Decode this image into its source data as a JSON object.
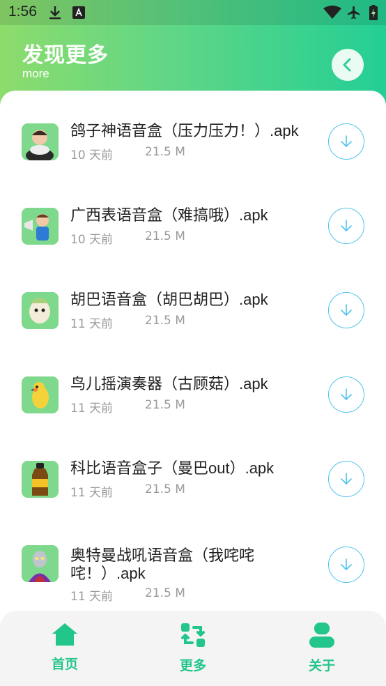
{
  "status_bar": {
    "time": "1:56",
    "icons": [
      "download-icon",
      "text-a-icon",
      "wifi-icon",
      "airplane-mode-icon",
      "battery-charging-icon"
    ]
  },
  "header": {
    "title": "发现更多",
    "subtitle": "more",
    "back_icon": "chevron-left-icon"
  },
  "colors": {
    "header_gradient_start": "#8ddc6c",
    "header_gradient_end": "#23cf95",
    "accent": "#22c58a",
    "download_ring": "#4fc3ec",
    "meta_text": "#9a9a9a"
  },
  "items": [
    {
      "title": "鸽子神语音盒（压力压力！）.apk",
      "age": "10 天前",
      "size": "21.5 M",
      "thumb_icon": "cartoon-character-thumbnail"
    },
    {
      "title": "广西表语音盒（难搞哦）.apk",
      "age": "10 天前",
      "size": "21.5 M",
      "thumb_icon": "megaphone-character-thumbnail"
    },
    {
      "title": "胡巴语音盒（胡巴胡巴）.apk",
      "age": "11 天前",
      "size": "21.5 M",
      "thumb_icon": "huba-character-thumbnail"
    },
    {
      "title": "鸟儿摇演奏器（古顾菇）.apk",
      "age": "11 天前",
      "size": "21.5 M",
      "thumb_icon": "parrot-thumbnail"
    },
    {
      "title": "科比语音盒子（曼巴out）.apk",
      "age": "11 天前",
      "size": "21.5 M",
      "thumb_icon": "bottle-thumbnail"
    },
    {
      "title": "奥特曼战吼语音盒（我咤咤咤！）.apk",
      "age": "11 天前",
      "size": "21.5 M",
      "thumb_icon": "ultraman-thumbnail"
    }
  ],
  "tabs": [
    {
      "label": "首页",
      "icon": "home-icon"
    },
    {
      "label": "更多",
      "icon": "refresh-swap-icon"
    },
    {
      "label": "关于",
      "icon": "user-icon"
    }
  ]
}
